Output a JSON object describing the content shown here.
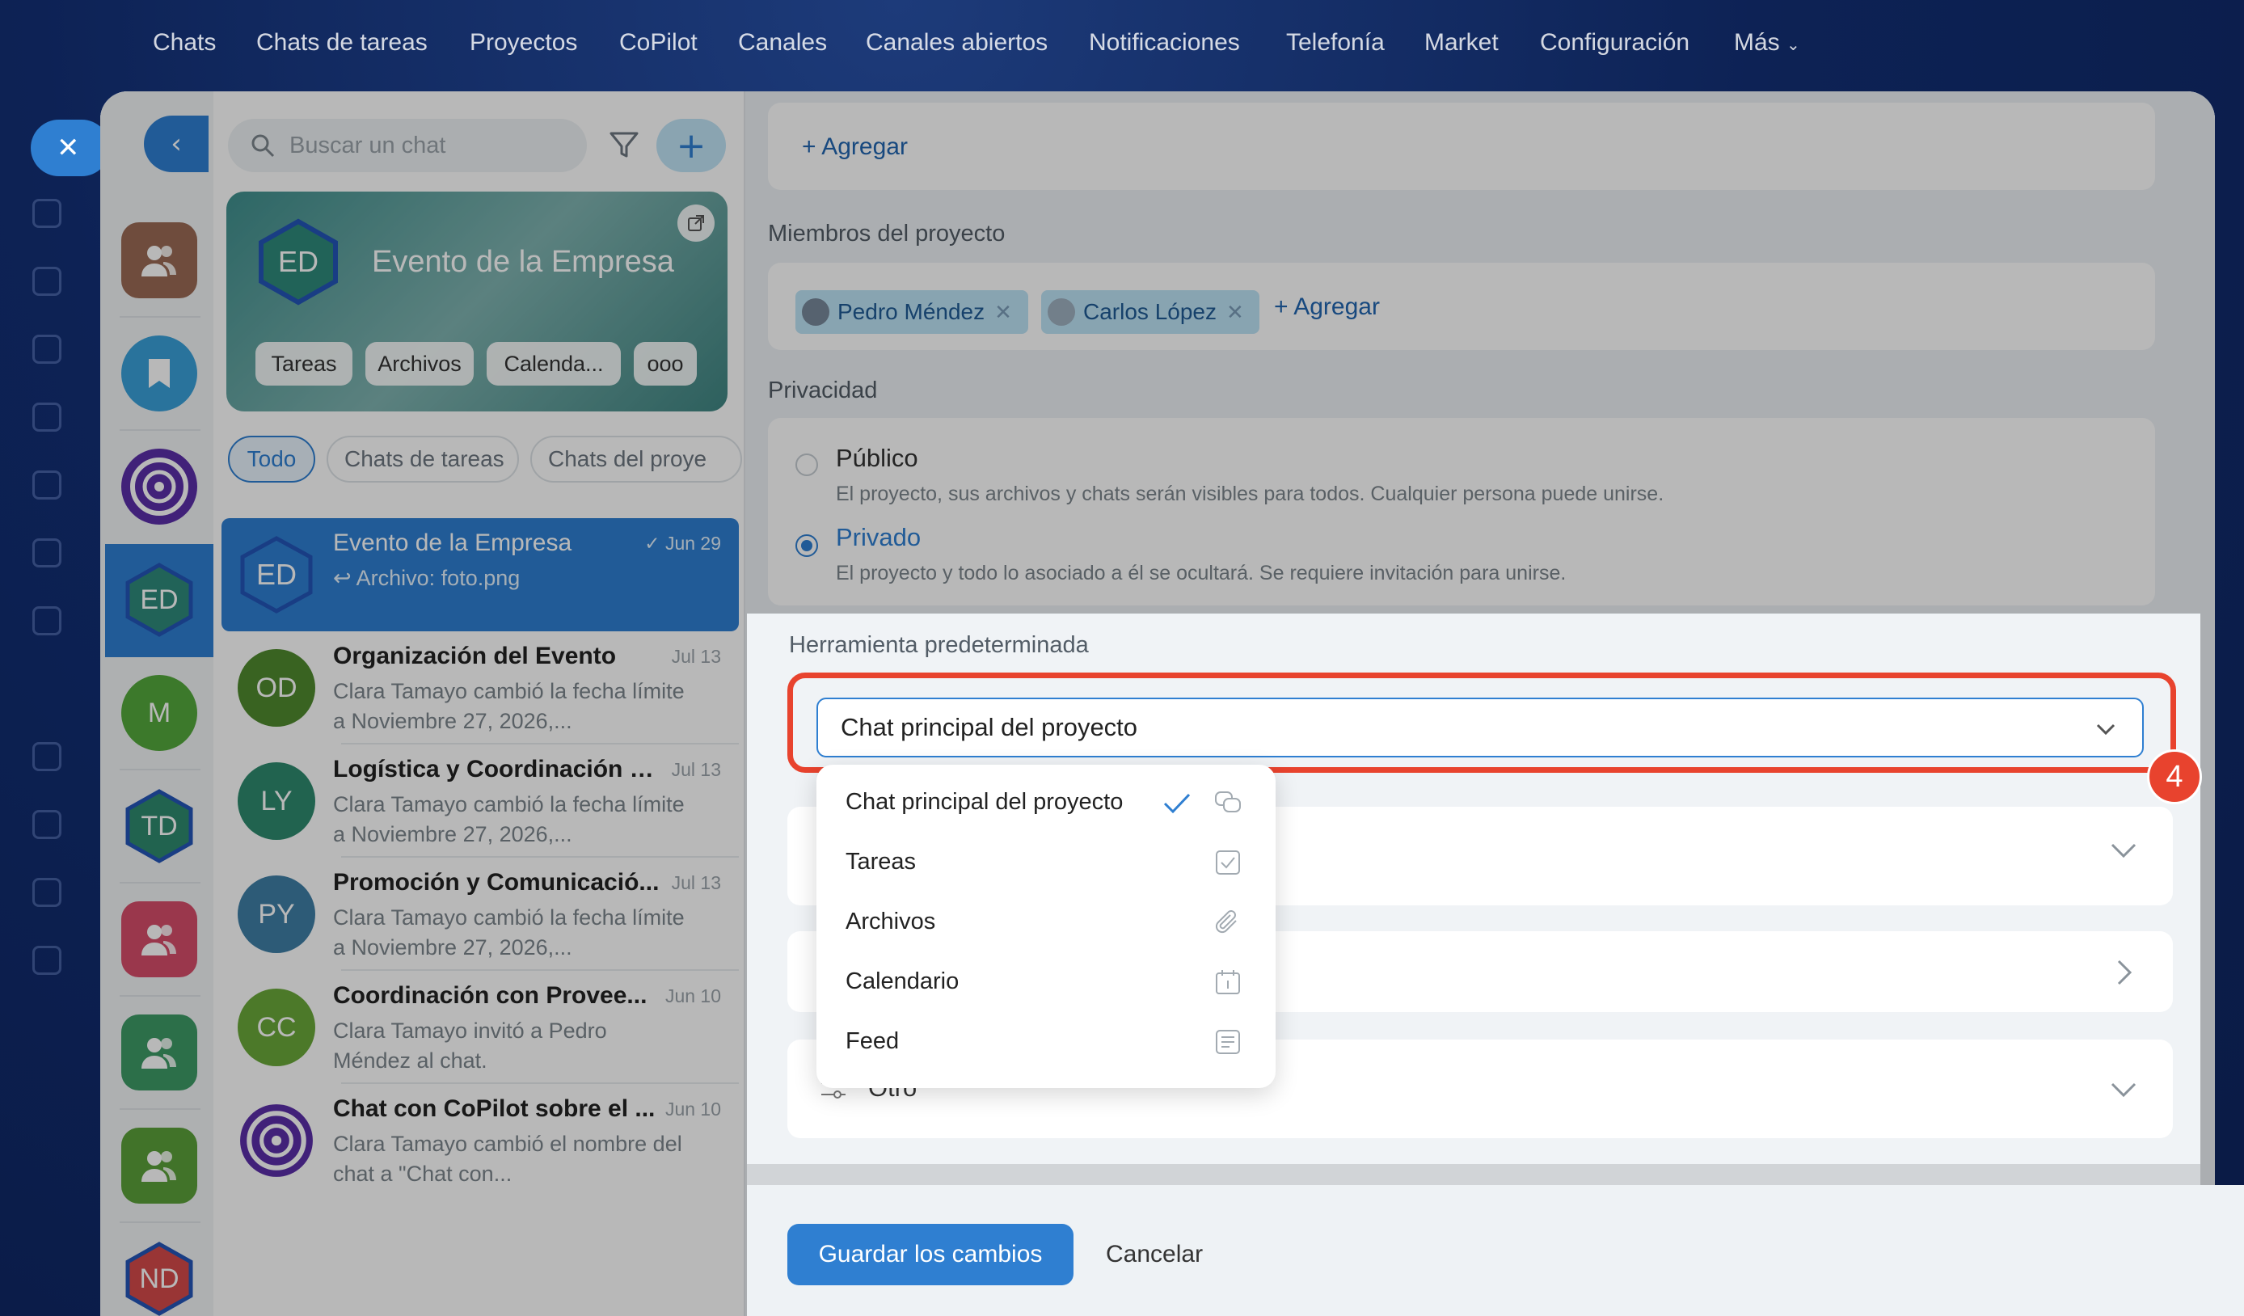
{
  "topnav": {
    "items": [
      "Chats",
      "Chats de tareas",
      "Proyectos",
      "CoPilot",
      "Canales",
      "Canales abiertos",
      "Notificaciones",
      "Telefonía",
      "Market",
      "Configuración",
      "Más"
    ]
  },
  "chatlist": {
    "search_placeholder": "Buscar un chat",
    "card": {
      "initials": "ED",
      "title": "Evento de la Empresa",
      "chips": [
        "Tareas",
        "Archivos",
        "Calenda..."
      ],
      "more": "ooo"
    },
    "tabs": [
      "Todo",
      "Chats de tareas",
      "Chats del proye"
    ],
    "rows": [
      {
        "initials": "ED",
        "name": "Evento de la Empresa",
        "date": "Jun 29",
        "text": "Archivo: foto.png",
        "color": "#2f7fd1"
      },
      {
        "initials": "OD",
        "name": "Organización del Evento",
        "date": "Jul 13",
        "text": "Clara Tamayo cambió la fecha límite a Noviembre 27, 2026,...",
        "color": "#4f8a2e"
      },
      {
        "initials": "LY",
        "name": "Logística y Coordinación d...",
        "date": "Jul 13",
        "text": "Clara Tamayo cambió la fecha límite a Noviembre 27, 2026,...",
        "color": "#2f8a6e"
      },
      {
        "initials": "PY",
        "name": "Promoción y Comunicació...",
        "date": "Jul 13",
        "text": "Clara Tamayo cambió la fecha límite a Noviembre 27, 2026,...",
        "color": "#3f7ea6"
      },
      {
        "initials": "CC",
        "name": "Coordinación con Provee...",
        "date": "Jun 10",
        "text": "Clara Tamayo invitó a Pedro Méndez al chat.",
        "color": "#6aa83a"
      },
      {
        "initials": "",
        "name": "Chat con CoPilot sobre el ...",
        "date": "Jun 10",
        "text": "Clara Tamayo cambió el nombre del chat a \"Chat con...",
        "color": "#5b2fa8"
      }
    ]
  },
  "recent": {
    "items": [
      {
        "initials": "",
        "color": "#9a6a55"
      },
      {
        "initials": "",
        "color": "#3aa0d8"
      },
      {
        "initials": "",
        "color": "#5b2fa8"
      },
      {
        "initials": "ED",
        "color": "#2f8a7a"
      },
      {
        "initials": "M",
        "color": "#54a83c"
      },
      {
        "initials": "TD",
        "color": "#2f8a6e"
      },
      {
        "initials": "",
        "color": "#d64d6a"
      },
      {
        "initials": "",
        "color": "#3e9a66"
      },
      {
        "initials": "",
        "color": "#5aa03a"
      },
      {
        "initials": "ND",
        "color": "#d44a4a"
      }
    ]
  },
  "settings": {
    "add_label": "+ Agregar",
    "members_label": "Miembros del proyecto",
    "members": [
      "Pedro Méndez",
      "Carlos López"
    ],
    "privacy_label": "Privacidad",
    "privacy": [
      {
        "title": "Público",
        "desc": "El proyecto, sus archivos y chats serán visibles para todos. Cualquier persona puede unirse."
      },
      {
        "title": "Privado",
        "desc": "El proyecto y todo lo asociado a él se ocultará. Se requiere invitación para unirse."
      }
    ],
    "default_tool_label": "Herramienta predeterminada",
    "selected_tool": "Chat principal del proyecto",
    "step_number": "4",
    "dropdown_options": [
      "Chat principal del proyecto",
      "Tareas",
      "Archivos",
      "Calendario",
      "Feed"
    ],
    "other_label": "Otro",
    "save_label": "Guardar los cambios",
    "cancel_label": "Cancelar"
  },
  "colors": {
    "accent": "#2f7fd1",
    "highlight": "#e8432e",
    "background": "#0c1f4d"
  }
}
